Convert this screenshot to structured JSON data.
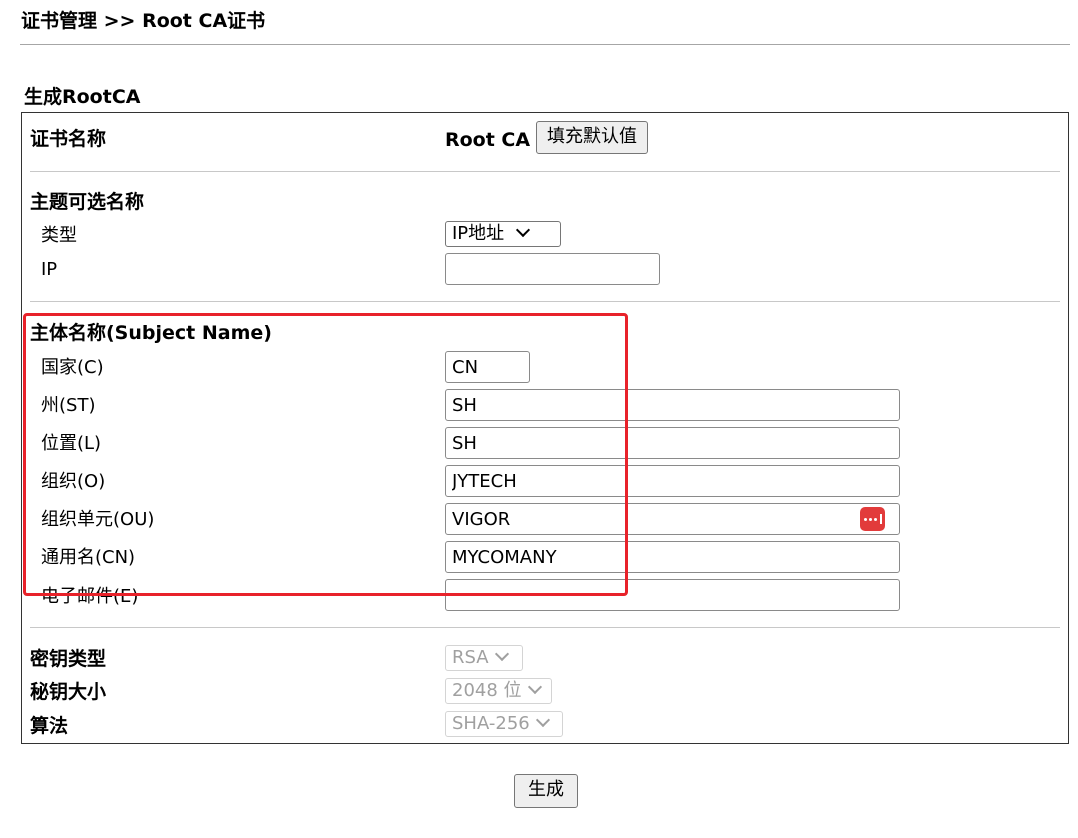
{
  "header": {
    "title": "证书管理 >> Root CA证书"
  },
  "section": {
    "title": "生成RootCA"
  },
  "cert_name": {
    "label": "证书名称",
    "value": "Root CA",
    "fill_default_button": "填充默认值"
  },
  "subject_alt_name": {
    "heading": "主题可选名称",
    "type_label": "类型",
    "type_value": "IP地址",
    "ip_label": "IP",
    "ip_value": ""
  },
  "subject_name": {
    "heading": "主体名称(Subject Name)",
    "fields": [
      {
        "label": "国家(C)",
        "value": "CN"
      },
      {
        "label": "州(ST)",
        "value": "SH"
      },
      {
        "label": "位置(L)",
        "value": "SH"
      },
      {
        "label": "组织(O)",
        "value": "JYTECH"
      },
      {
        "label": "组织单元(OU)",
        "value": "VIGOR"
      },
      {
        "label": "通用名(CN)",
        "value": "MYCOMANY"
      },
      {
        "label": "电子邮件(E)",
        "value": ""
      }
    ]
  },
  "key": {
    "type_label": "密钥类型",
    "type_value": "RSA",
    "size_label": "秘钥大小",
    "size_value": "2048 位",
    "algo_label": "算法",
    "algo_value": "SHA-256"
  },
  "generate_button": "生成",
  "colors": {
    "highlight": "#e8222a",
    "password_icon": "#e23b3b"
  },
  "icons": {
    "password_manager": "password-dots-icon"
  }
}
